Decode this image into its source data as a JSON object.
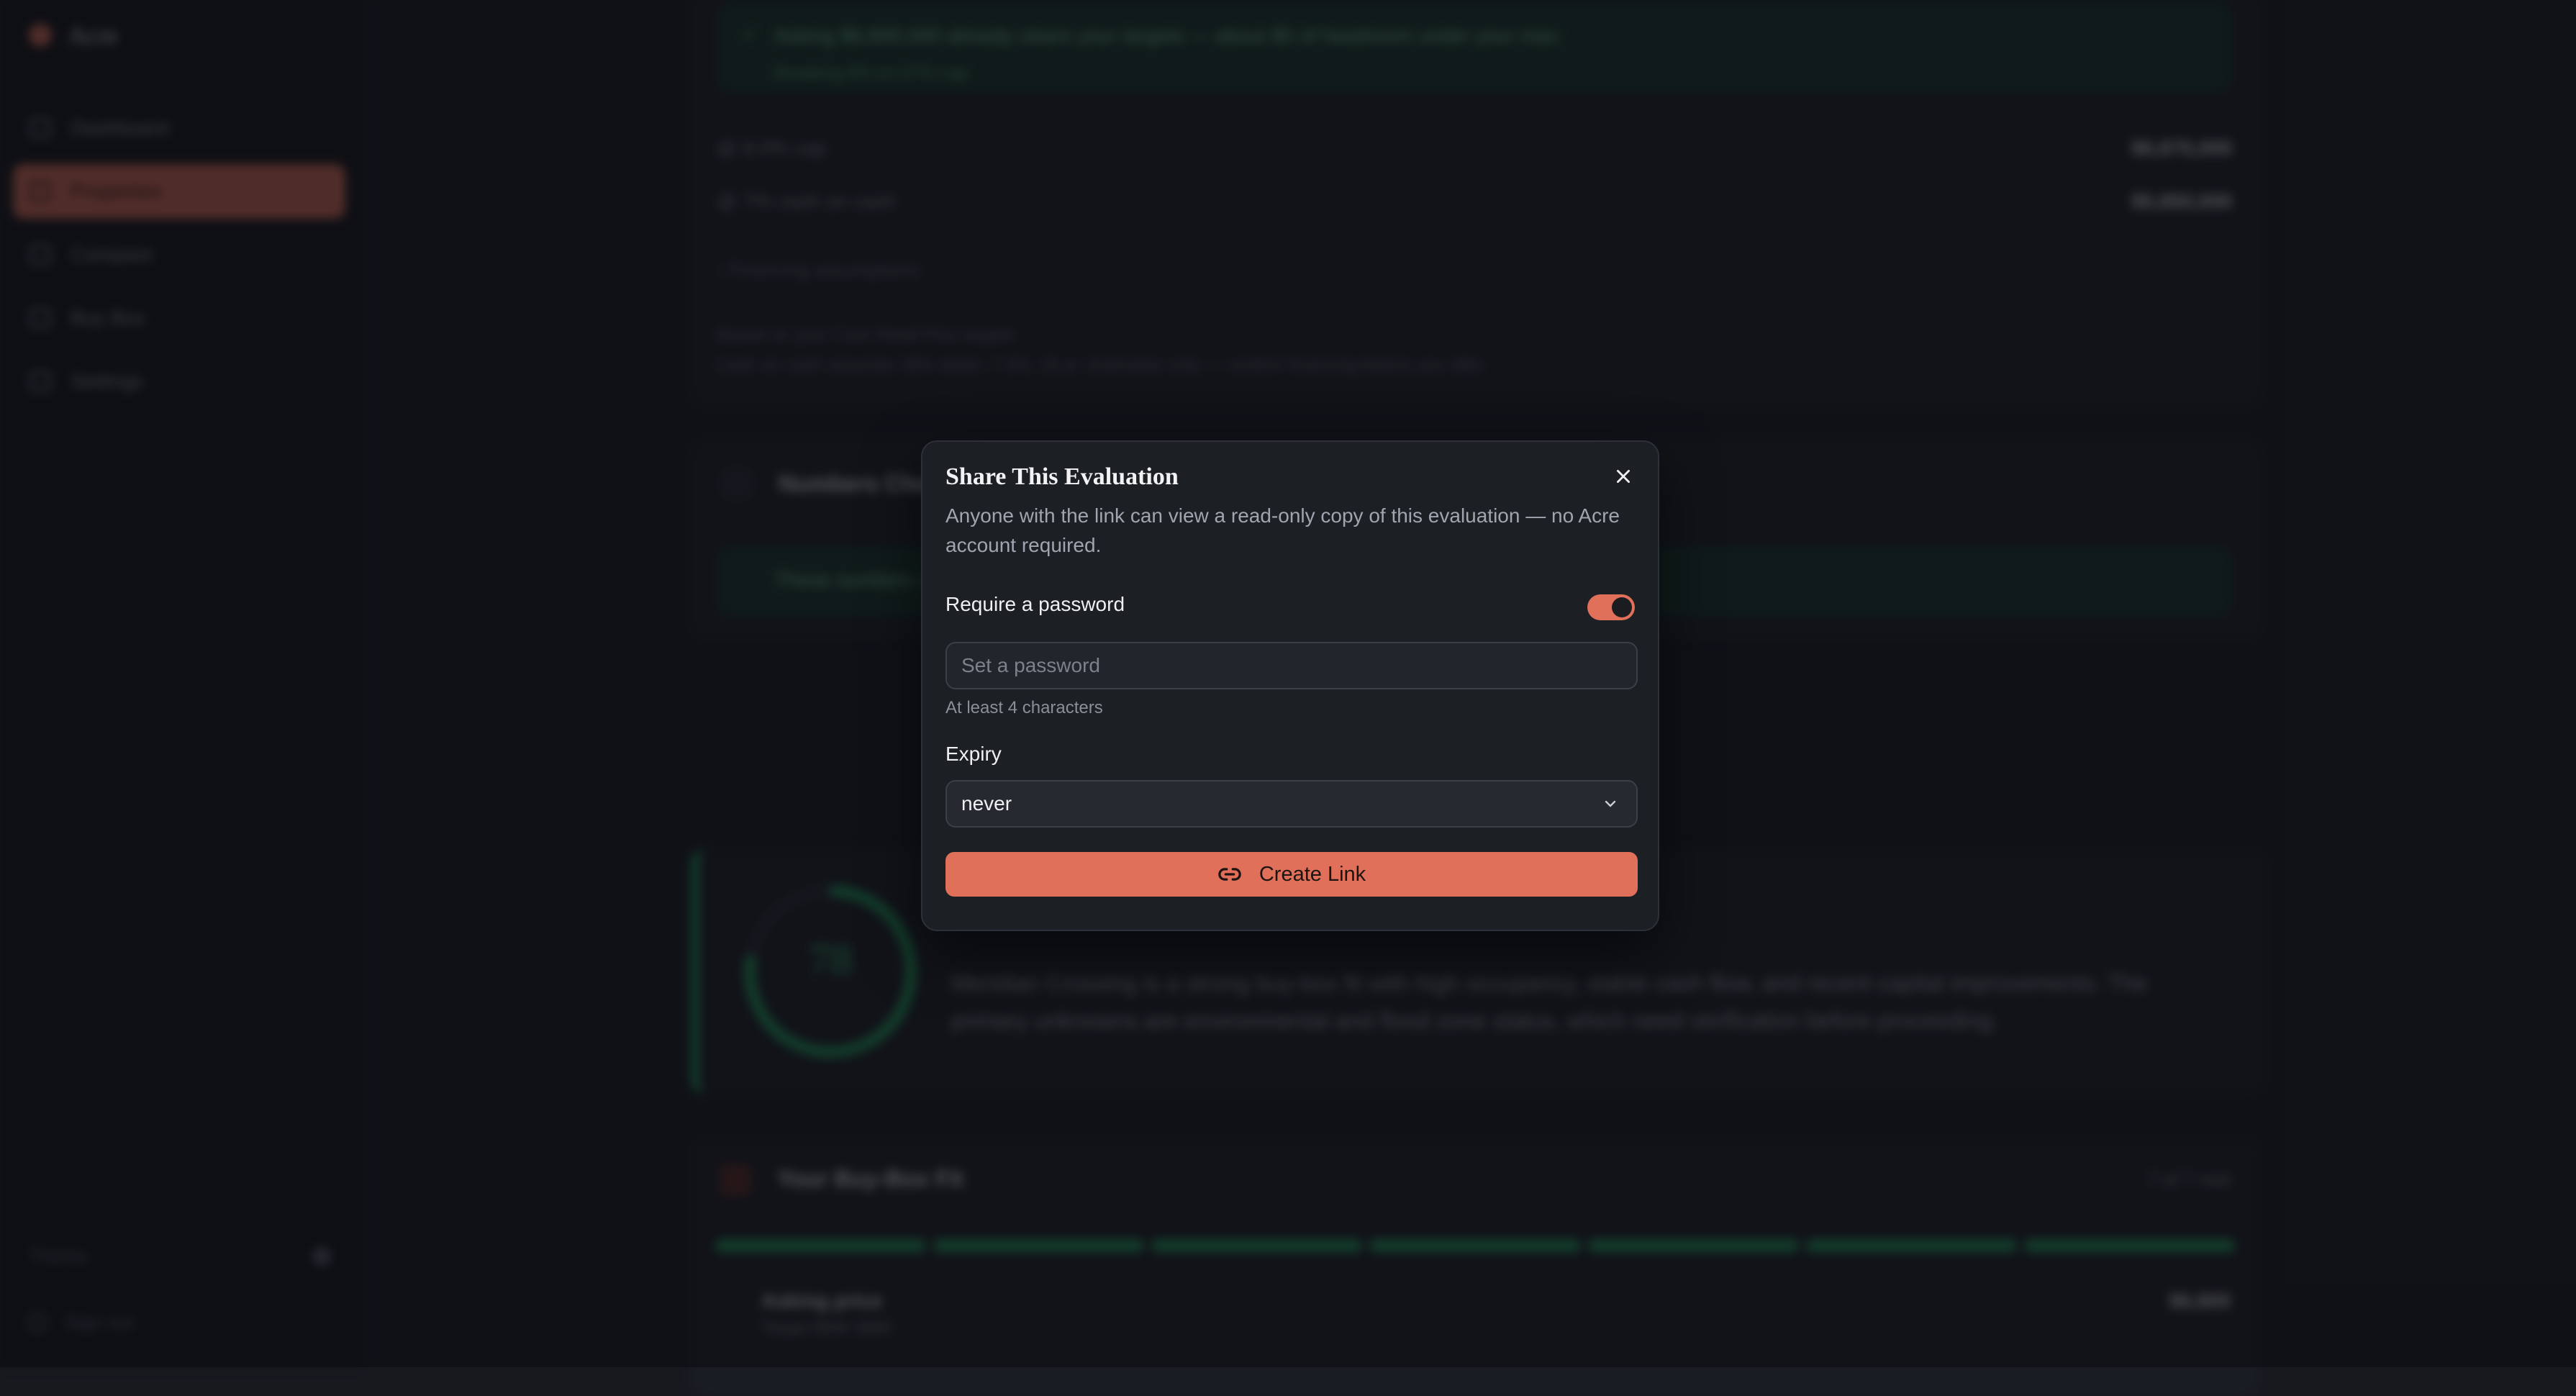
{
  "app": {
    "brand": "Acre",
    "nav": [
      {
        "label": "Dashboard"
      },
      {
        "label": "Properties"
      },
      {
        "label": "Compare"
      },
      {
        "label": "Buy Box"
      },
      {
        "label": "Settings"
      }
    ],
    "theme_label": "Theme",
    "sign_out": "Sign out"
  },
  "background": {
    "banner_line1": "Asking $6,800,000 already clears your targets — about $5 of headroom under your max.",
    "banner_line2": "Breaking 8% on 27% cap",
    "row1_label": "@ 8.0% cap",
    "row1_value": "$6,875,000",
    "row2_label": "@ 7% cash on cash",
    "row2_value": "$5,850,000",
    "financing_toggle": "› Financing assumptions",
    "note_line1": "Based on your Core Retail Plus targets",
    "note_line2": "Cash on cash assumes 30% down, 7.0%, 25-yr. Estimates only — confirm financing before you offer.",
    "numbers_title": "Numbers Check",
    "numbers_banner": "These numbers check out against the rent roll.",
    "score_value": "78",
    "score_text": "Meridian Crossing is a strong buy-box fit with high occupancy, stable cash flow, and recent capital improvements. The primary unknowns are environmental and flood zone status, which need verification before proceeding.",
    "buybox_title": "Your Buy-Box Fit",
    "buybox_count": "7 of 7 met",
    "buybox_row_label": "Asking price",
    "buybox_row_sub": "Target $5M–$8M",
    "buybox_row_value": "$6,800"
  },
  "modal": {
    "title": "Share This Evaluation",
    "description": "Anyone with the link can view a read-only copy of this evaluation — no Acre account required.",
    "password_label": "Require a password",
    "password_enabled": true,
    "password_placeholder": "Set a password",
    "password_value": "",
    "password_hint": "At least 4 characters",
    "expiry_label": "Expiry",
    "expiry_value": "never",
    "create_label": "Create Link"
  },
  "colors": {
    "accent": "#e0705a",
    "success": "#1fa15f",
    "modal_bg": "#1c1f24"
  }
}
